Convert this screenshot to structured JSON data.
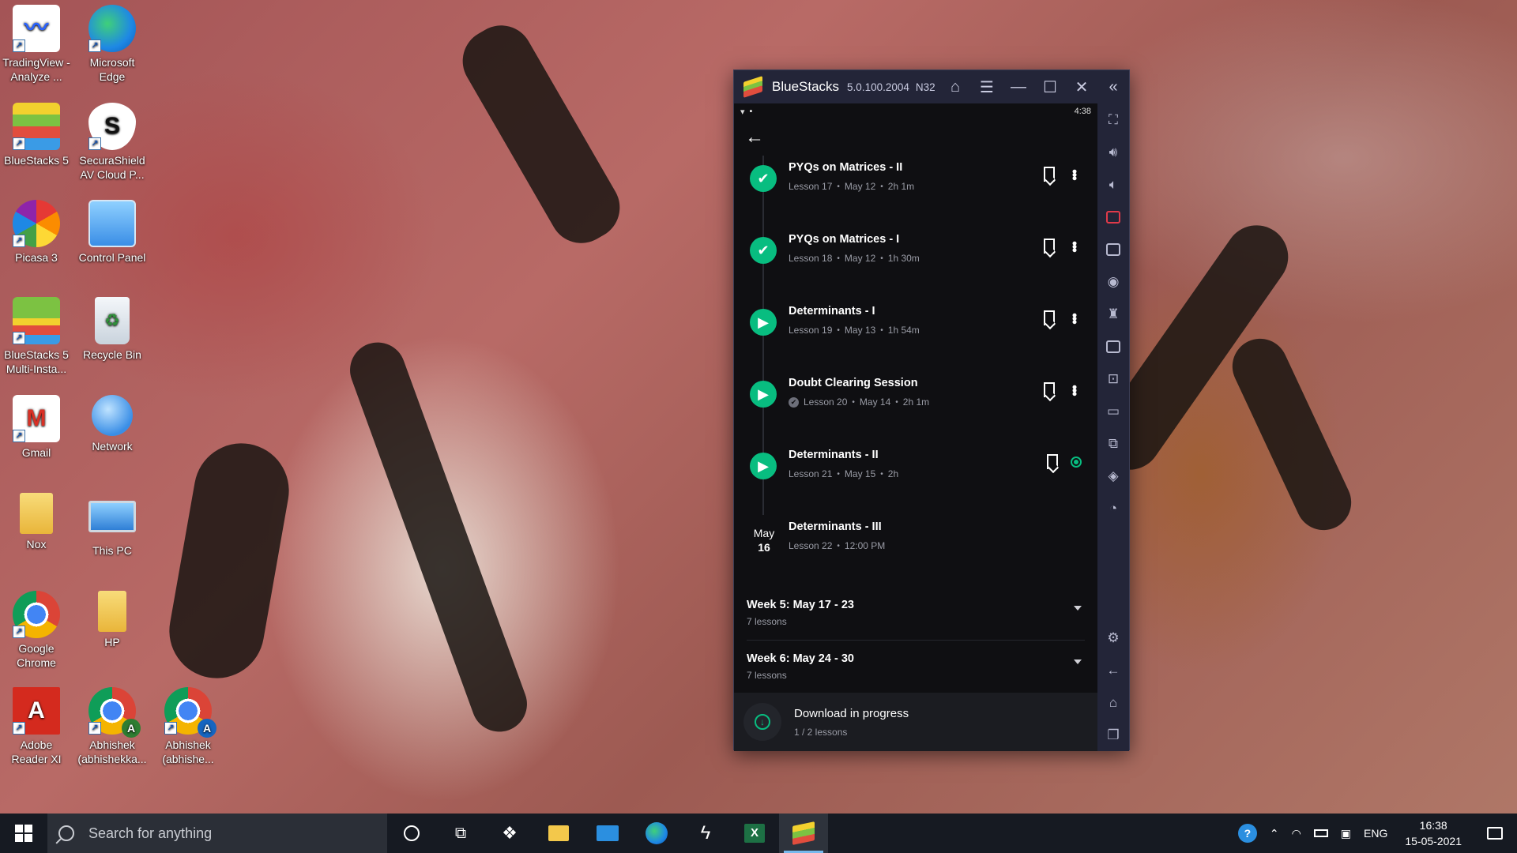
{
  "desktop": {
    "icons": [
      {
        "label": "TradingView - Analyze ...",
        "icon": "tradingview-icon",
        "color": "#ffffff"
      },
      {
        "label": "Microsoft Edge",
        "icon": "edge-icon",
        "color": "#1e88e5"
      },
      {
        "label": "BlueStacks 5",
        "icon": "bluestacks-icon",
        "color": "#7cc242"
      },
      {
        "label": "SecuraShield AV Cloud P...",
        "icon": "shield-icon",
        "color": "#ffffff"
      },
      {
        "label": "Picasa 3",
        "icon": "picasa-icon",
        "color": "#ffffff"
      },
      {
        "label": "Control Panel",
        "icon": "control-panel-icon",
        "color": "#4a90d9"
      },
      {
        "label": "BlueStacks 5 Multi-Insta...",
        "icon": "bluestacks-multi-icon",
        "color": "#7cc242"
      },
      {
        "label": "Recycle Bin",
        "icon": "recycle-bin-icon",
        "color": "#dfe6ee"
      },
      {
        "label": "Gmail",
        "icon": "gmail-icon",
        "color": "#ffffff"
      },
      {
        "label": "Network",
        "icon": "network-icon",
        "color": "#3a8ee6"
      },
      {
        "label": "Nox",
        "icon": "folder-icon",
        "color": "#f3c84b"
      },
      {
        "label": "This PC",
        "icon": "computer-icon",
        "color": "#5aa7f0"
      },
      {
        "label": "Google Chrome",
        "icon": "chrome-icon",
        "color": "#ffffff"
      },
      {
        "label": "HP",
        "icon": "user-folder-icon",
        "color": "#f3c84b"
      },
      {
        "label": "Adobe Reader XI",
        "icon": "pdf-icon",
        "color": "#d42a1e"
      },
      {
        "label": "Abhishek (abhishekka...",
        "icon": "chrome-profile-icon",
        "color": "#ffffff"
      },
      {
        "label": "Abhishek (abhishe...",
        "icon": "chrome-profile-icon",
        "color": "#ffffff"
      }
    ]
  },
  "window": {
    "title": "BlueStacks",
    "version": "5.0.100.2004",
    "arch": "N32"
  },
  "android": {
    "status_time": "4:38",
    "lessons": [
      {
        "title": "PYQs on Matrices - II",
        "lesson": "Lesson 17",
        "date": "May 12",
        "duration": "2h 1m",
        "state": "completed"
      },
      {
        "title": "PYQs on Matrices - I",
        "lesson": "Lesson 18",
        "date": "May 12",
        "duration": "1h 30m",
        "state": "completed"
      },
      {
        "title": "Determinants - I",
        "lesson": "Lesson 19",
        "date": "May 13",
        "duration": "1h 54m",
        "state": "play"
      },
      {
        "title": "Doubt Clearing Session",
        "lesson": "Lesson 20",
        "date": "May 14",
        "duration": "2h 1m",
        "state": "play"
      },
      {
        "title": "Determinants - II",
        "lesson": "Lesson 21",
        "date": "May 15",
        "duration": "2h",
        "state": "play"
      },
      {
        "title": "Determinants - III",
        "lesson": "Lesson 22",
        "time": "12:00 PM",
        "month": "May",
        "day": "16",
        "state": "upcoming"
      }
    ],
    "weeks": [
      {
        "title": "Week 5:  May 17 - 23",
        "count": "7 lessons"
      },
      {
        "title": "Week 6:  May 24 - 30",
        "count": "7 lessons"
      }
    ],
    "download": {
      "title": "Download in progress",
      "sub": "1 / 2 lessons"
    },
    "accent": "#08bd80"
  },
  "taskbar": {
    "search_placeholder": "Search for anything",
    "lang": "ENG",
    "time": "16:38",
    "date": "15-05-2021"
  }
}
